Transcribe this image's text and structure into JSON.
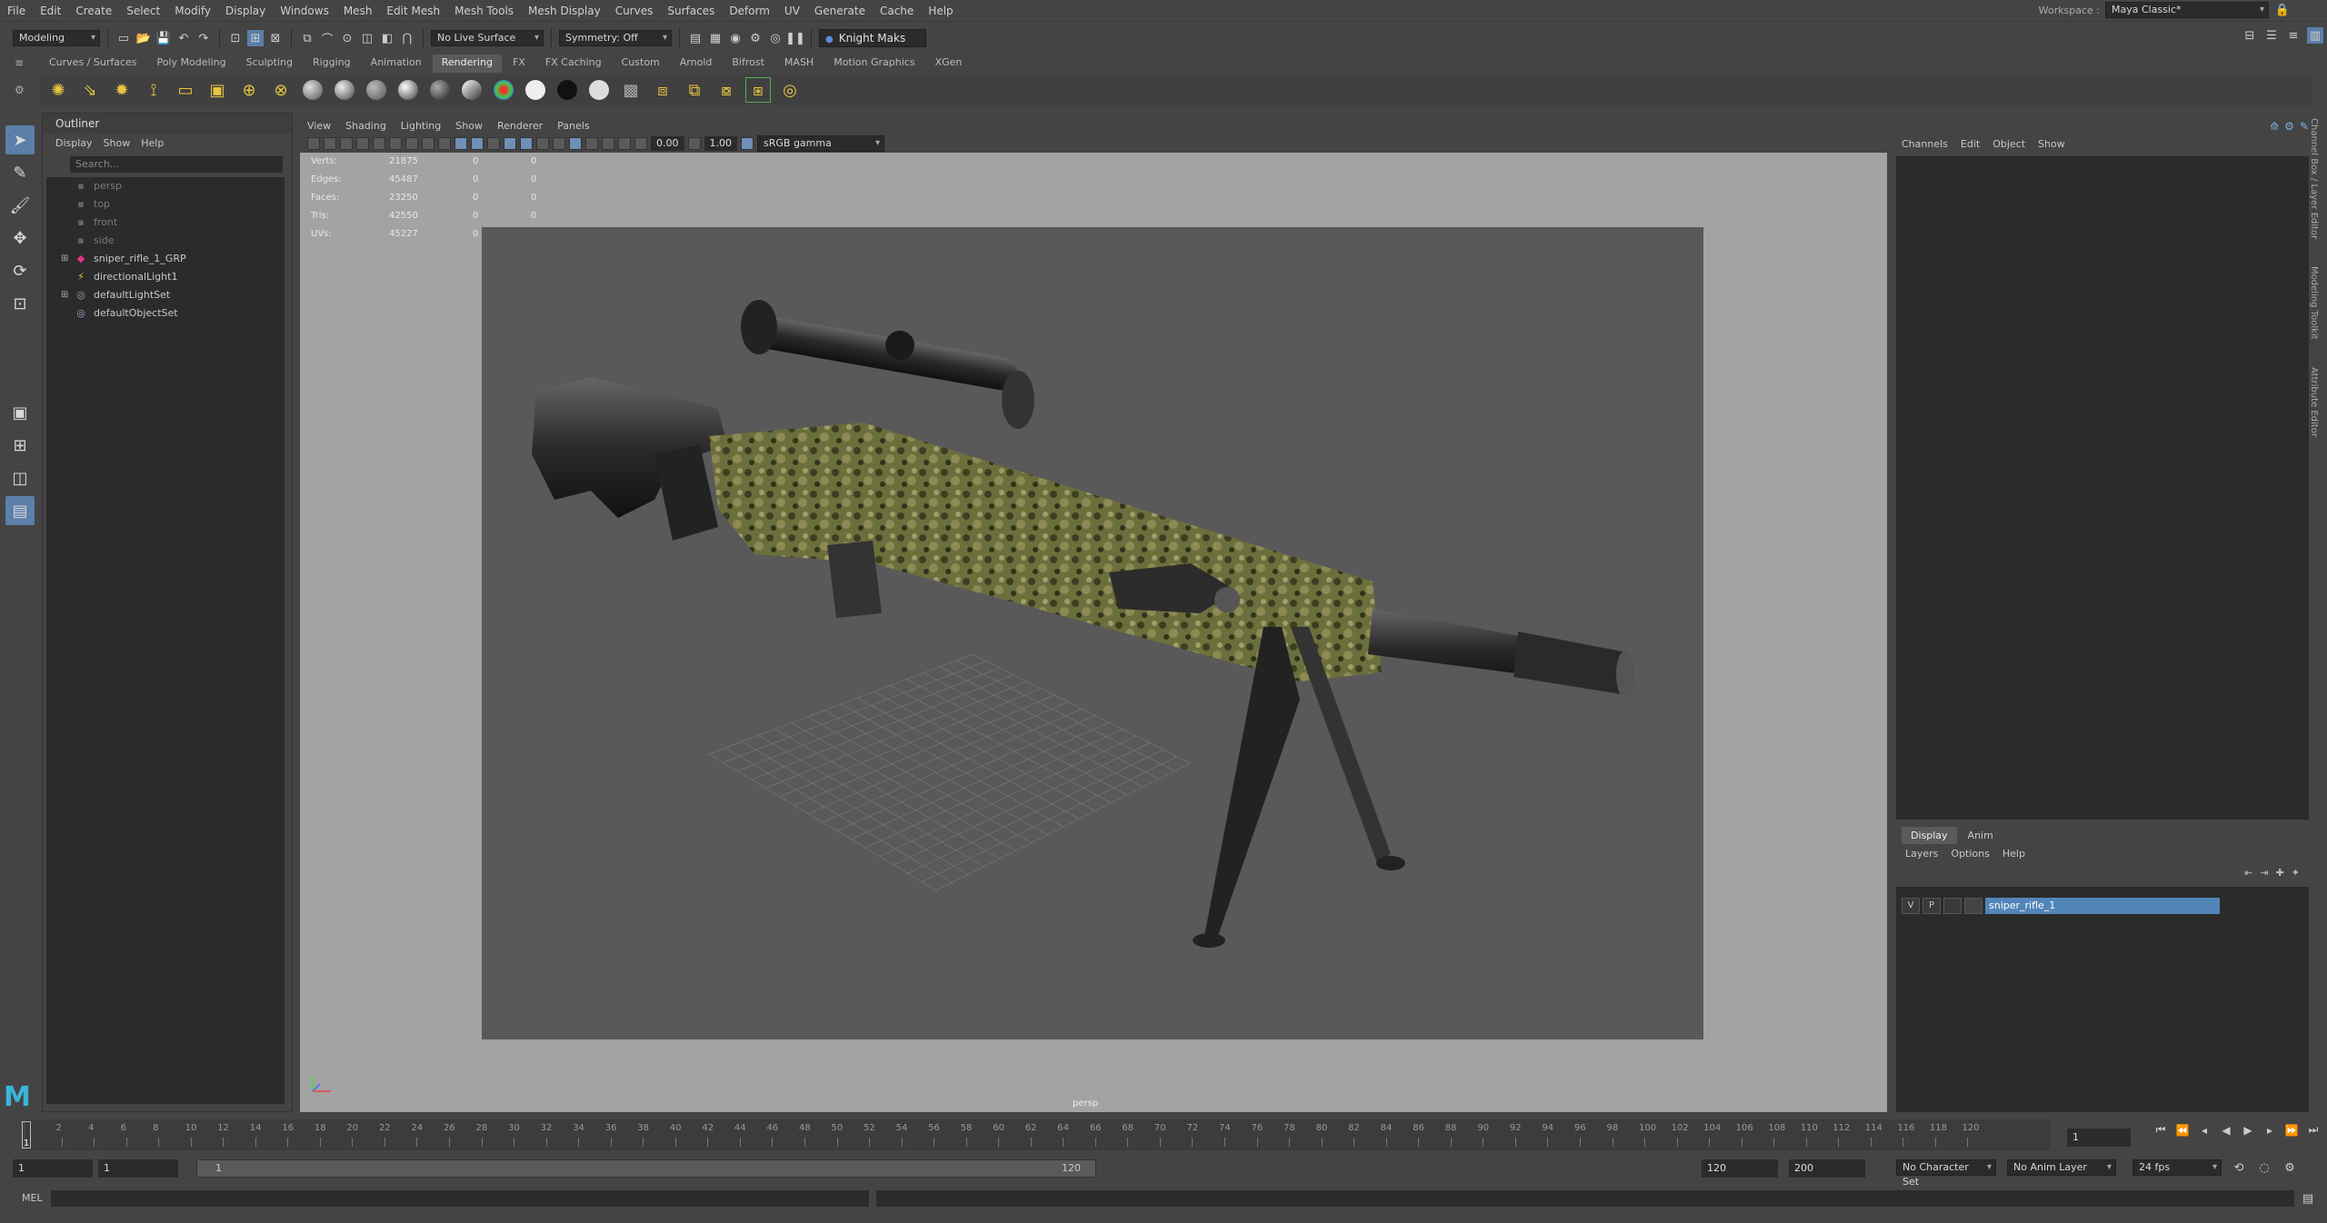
{
  "menubar": {
    "items": [
      "File",
      "Edit",
      "Create",
      "Select",
      "Modify",
      "Display",
      "Windows",
      "Mesh",
      "Edit Mesh",
      "Mesh Tools",
      "Mesh Display",
      "Curves",
      "Surfaces",
      "Deform",
      "UV",
      "Generate",
      "Cache",
      "Help"
    ],
    "workspace_label": "Workspace :",
    "workspace_value": "Maya Classic*"
  },
  "statusline": {
    "mode": "Modeling",
    "live_surface": "No Live Surface",
    "symmetry": "Symmetry: Off",
    "user": "Knight Maks"
  },
  "shelf": {
    "tabs": [
      "Curves / Surfaces",
      "Poly Modeling",
      "Sculpting",
      "Rigging",
      "Animation",
      "Rendering",
      "FX",
      "FX Caching",
      "Custom",
      "Arnold",
      "Bifrost",
      "MASH",
      "Motion Graphics",
      "XGen"
    ],
    "active_tab": "Rendering"
  },
  "outliner": {
    "title": "Outliner",
    "menus": [
      "Display",
      "Show",
      "Help"
    ],
    "search_placeholder": "Search...",
    "items": [
      {
        "label": "persp",
        "dim": true,
        "icon": "camera-icon",
        "expandable": false
      },
      {
        "label": "top",
        "dim": true,
        "icon": "camera-icon",
        "expandable": false
      },
      {
        "label": "front",
        "dim": true,
        "icon": "camera-icon",
        "expandable": false
      },
      {
        "label": "side",
        "dim": true,
        "icon": "camera-icon",
        "expandable": false
      },
      {
        "label": "sniper_rifle_1_GRP",
        "dim": false,
        "icon": "group-icon",
        "expandable": true
      },
      {
        "label": "directionalLight1",
        "dim": false,
        "icon": "light-icon",
        "expandable": false
      },
      {
        "label": "defaultLightSet",
        "dim": false,
        "icon": "set-icon",
        "expandable": true
      },
      {
        "label": "defaultObjectSet",
        "dim": false,
        "icon": "set-icon",
        "expandable": false
      }
    ]
  },
  "viewport": {
    "menus": [
      "View",
      "Shading",
      "Lighting",
      "Show",
      "Renderer",
      "Panels"
    ],
    "exposure": "0.00",
    "gamma": "1.00",
    "colorspace": "sRGB gamma",
    "camera": "persp",
    "hud": [
      {
        "label": "Verts:",
        "v1": "21875",
        "v2": "0",
        "v3": "0"
      },
      {
        "label": "Edges:",
        "v1": "45487",
        "v2": "0",
        "v3": "0"
      },
      {
        "label": "Faces:",
        "v1": "23250",
        "v2": "0",
        "v3": "0"
      },
      {
        "label": "Tris:",
        "v1": "42550",
        "v2": "0",
        "v3": "0"
      },
      {
        "label": "UVs:",
        "v1": "45227",
        "v2": "0",
        "v3": "0"
      }
    ]
  },
  "channelbox": {
    "menus": [
      "Channels",
      "Edit",
      "Object",
      "Show"
    ],
    "side_tabs": [
      "Channel Box / Layer Editor",
      "Modeling Toolkit",
      "Attribute Editor"
    ]
  },
  "layers": {
    "tabs": [
      "Display",
      "Anim"
    ],
    "menus": [
      "Layers",
      "Options",
      "Help"
    ],
    "row": {
      "v": "V",
      "p": "P",
      "name": "sniper_rifle_1"
    }
  },
  "timeslider": {
    "ticks": [
      "2",
      "4",
      "6",
      "8",
      "10",
      "12",
      "14",
      "16",
      "18",
      "20",
      "22",
      "24",
      "26",
      "28",
      "30",
      "32",
      "34",
      "36",
      "38",
      "40",
      "42",
      "44",
      "46",
      "48",
      "50",
      "52",
      "54",
      "56",
      "58",
      "60",
      "62",
      "64",
      "66",
      "68",
      "70",
      "72",
      "74",
      "76",
      "78",
      "80",
      "82",
      "84",
      "86",
      "88",
      "90",
      "92",
      "94",
      "96",
      "98",
      "100",
      "102",
      "104",
      "106",
      "108",
      "110",
      "112",
      "114",
      "116",
      "118",
      "120"
    ],
    "current_frame": "1",
    "frame_field": "1"
  },
  "range": {
    "start": "1",
    "start2": "1",
    "inner_start": "1",
    "inner_end": "120",
    "end": "120",
    "end2": "200",
    "character_set": "No Character Set",
    "anim_layer": "No Anim Layer",
    "fps": "24 fps"
  },
  "cmdline": {
    "label": "MEL"
  }
}
